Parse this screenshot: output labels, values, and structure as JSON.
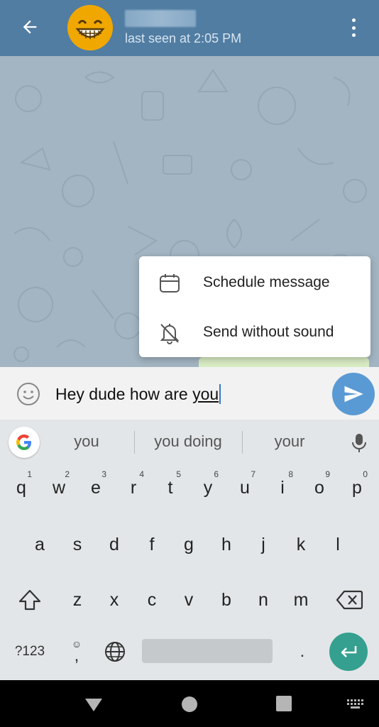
{
  "header": {
    "back_icon": "arrow-back-icon",
    "avatar_icon": "grinning-face-emoji",
    "contact_name": "",
    "status": "last seen at 2:05 PM",
    "menu_icon": "more-vertical-icon",
    "color": "#517da2"
  },
  "popup_menu": {
    "items": [
      {
        "icon": "calendar-icon",
        "label": "Schedule message"
      },
      {
        "icon": "bell-off-icon",
        "label": "Send without sound"
      }
    ]
  },
  "composer": {
    "emoji_icon": "smiley-icon",
    "text_prefix": "Hey dude how are ",
    "text_composing": "you",
    "send_icon": "send-icon",
    "send_color": "#5a9ad4"
  },
  "keyboard": {
    "suggestions": [
      "you",
      "you doing",
      "your"
    ],
    "google_icon": "google-g-icon",
    "mic_icon": "microphone-icon",
    "row1": [
      {
        "k": "q",
        "h": "1"
      },
      {
        "k": "w",
        "h": "2"
      },
      {
        "k": "e",
        "h": "3"
      },
      {
        "k": "r",
        "h": "4"
      },
      {
        "k": "t",
        "h": "5"
      },
      {
        "k": "y",
        "h": "6"
      },
      {
        "k": "u",
        "h": "7"
      },
      {
        "k": "i",
        "h": "8"
      },
      {
        "k": "o",
        "h": "9"
      },
      {
        "k": "p",
        "h": "0"
      }
    ],
    "row2": [
      "a",
      "s",
      "d",
      "f",
      "g",
      "h",
      "j",
      "k",
      "l"
    ],
    "row3": [
      "z",
      "x",
      "c",
      "v",
      "b",
      "n",
      "m"
    ],
    "shift_icon": "shift-icon",
    "backspace_icon": "backspace-icon",
    "symbols_label": "?123",
    "comma_label": ",",
    "globe_icon": "globe-icon",
    "period_label": ".",
    "enter_icon": "enter-icon",
    "enter_color": "#35a08f"
  },
  "navbar": {
    "back_icon": "nav-back-triangle-icon",
    "home_icon": "nav-home-circle-icon",
    "recents_icon": "nav-recents-square-icon",
    "keyboard_icon": "keyboard-switch-icon"
  }
}
